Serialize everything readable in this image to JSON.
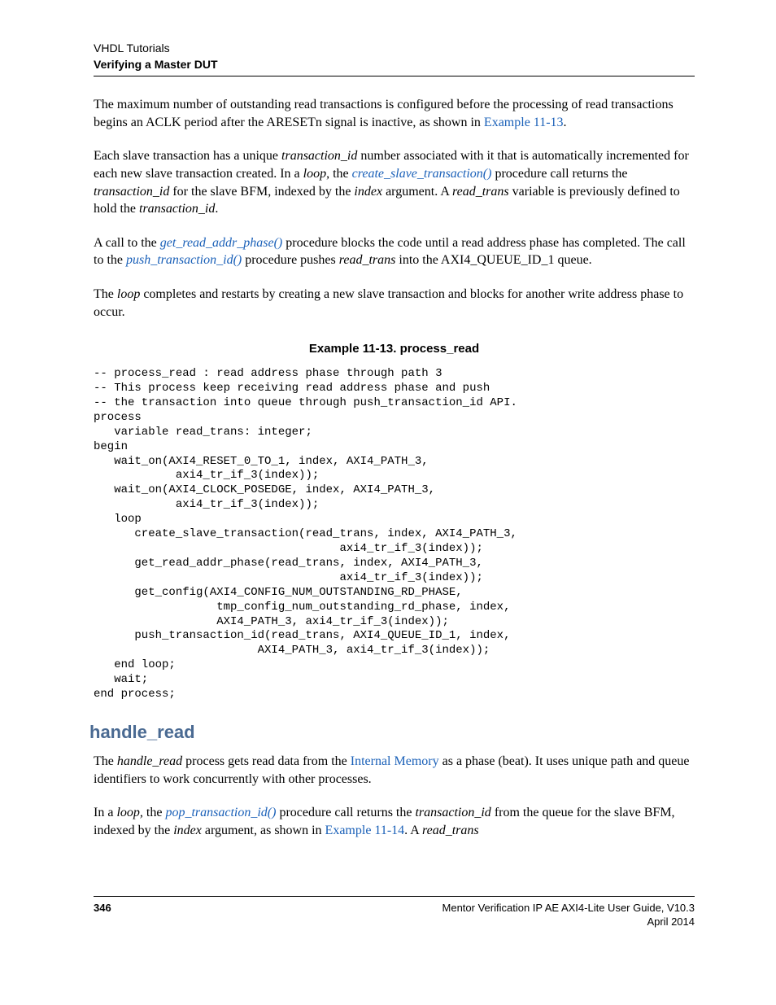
{
  "header": {
    "chapter": "VHDL Tutorials",
    "section": "Verifying a Master DUT"
  },
  "para1": {
    "t1": "The maximum number of outstanding read transactions is configured before the processing of read transactions begins an ACLK period after the ARESETn signal is inactive, as shown in ",
    "link": "Example 11-13",
    "t2": "."
  },
  "para2": {
    "t1": "Each slave transaction has a unique ",
    "i1": "transaction_id",
    "t2": " number associated with it that is automatically incremented for each new slave transaction created. In a ",
    "i2": "loop",
    "t3": ", the ",
    "link1": "create_slave_transaction()",
    "t4": " procedure call returns the ",
    "i3": "transaction_id",
    "t5": " for the slave BFM, indexed by the ",
    "i4": "index",
    "t6": " argument. A ",
    "i5": "read_trans",
    "t7": " variable is previously defined to hold the ",
    "i6": "transaction_id",
    "t8": "."
  },
  "para3": {
    "t1": "A call to the ",
    "link1": "get_read_addr_phase()",
    "t2": " procedure blocks the code until a read address phase has completed. The call to the ",
    "link2": "push_transaction_id()",
    "t3": " procedure pushes ",
    "i1": "read_trans",
    "t4": " into the AXI4_QUEUE_ID_1 queue."
  },
  "para4": {
    "t1": "The ",
    "i1": "loop",
    "t2": " completes and restarts by creating a new slave transaction and blocks for another write address phase to occur."
  },
  "example_title": "Example 11-13. process_read",
  "code": "-- process_read : read address phase through path 3\n-- This process keep receiving read address phase and push\n-- the transaction into queue through push_transaction_id API.\nprocess\n   variable read_trans: integer;\nbegin\n   wait_on(AXI4_RESET_0_TO_1, index, AXI4_PATH_3,\n            axi4_tr_if_3(index));\n   wait_on(AXI4_CLOCK_POSEDGE, index, AXI4_PATH_3,\n            axi4_tr_if_3(index));\n   loop\n      create_slave_transaction(read_trans, index, AXI4_PATH_3,\n                                    axi4_tr_if_3(index));\n      get_read_addr_phase(read_trans, index, AXI4_PATH_3,\n                                    axi4_tr_if_3(index));\n      get_config(AXI4_CONFIG_NUM_OUTSTANDING_RD_PHASE,\n                  tmp_config_num_outstanding_rd_phase, index,\n                  AXI4_PATH_3, axi4_tr_if_3(index));\n      push_transaction_id(read_trans, AXI4_QUEUE_ID_1, index,\n                        AXI4_PATH_3, axi4_tr_if_3(index));\n   end loop;\n   wait;\nend process;",
  "section_heading": "handle_read",
  "para5": {
    "t1": "The ",
    "i1": "handle_read",
    "t2": " process gets read data from the ",
    "link1": "Internal Memory",
    "t3": " as a  phase (beat). It uses unique path and queue identifiers to work concurrently with other processes."
  },
  "para6": {
    "t1": "In a ",
    "i1": "loop,",
    "t2": " the ",
    "link1": "pop_transaction_id()",
    "t3": " procedure call returns the ",
    "i2": "transaction_id",
    "t4": " from the queue for the slave BFM, indexed by the ",
    "i3": "index",
    "t5": " argument, as shown in ",
    "link2": "Example 11-14",
    "t6": ". A ",
    "i4": "read_trans"
  },
  "footer": {
    "page": "346",
    "title": "Mentor Verification IP AE AXI4-Lite User Guide, V10.3",
    "date": "April 2014"
  }
}
